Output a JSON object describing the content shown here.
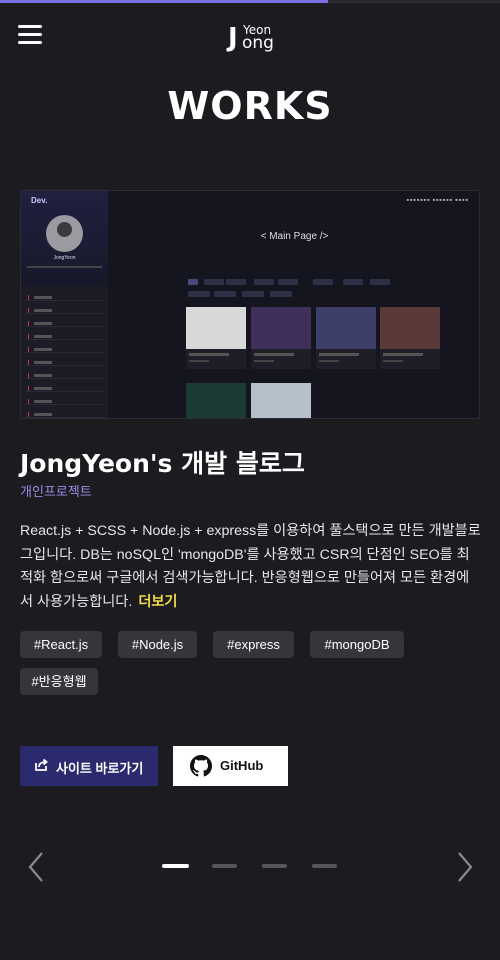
{
  "progress": 0.655,
  "header": {
    "logo_big": "J",
    "logo_top": "Yeon",
    "logo_bottom": "ong"
  },
  "section_title": "WORKS",
  "preview": {
    "brand": "Dev.",
    "profile_name": "JongYeon",
    "main_heading": "< Main Page />"
  },
  "project": {
    "title": "JongYeon's 개발 블로그",
    "type": "개인프로젝트",
    "description": "React.js + SCSS + Node.js + express를 이용하여 풀스택으로 만든 개발블로그입니다. DB는 noSQL인 'mongoDB'를 사용했고 CSR의 단점인 SEO를 최적화 함으로써 구글에서 검색가능합니다. 반응형웹으로 만들어져 모든 환경에서 사용가능합니다.",
    "more_label": "더보기",
    "tags": [
      "#React.js",
      "#Node.js",
      "#express",
      "#mongoDB",
      "#반응형웹"
    ]
  },
  "buttons": {
    "site": "사이트 바로가기",
    "github": "GitHub"
  },
  "carousel": {
    "total": 4,
    "active": 1
  },
  "colors": {
    "accent": "#7b6ee0",
    "highlight": "#f2d94e",
    "primary_button": "#2c2a6e",
    "background": "#1b1b20"
  }
}
